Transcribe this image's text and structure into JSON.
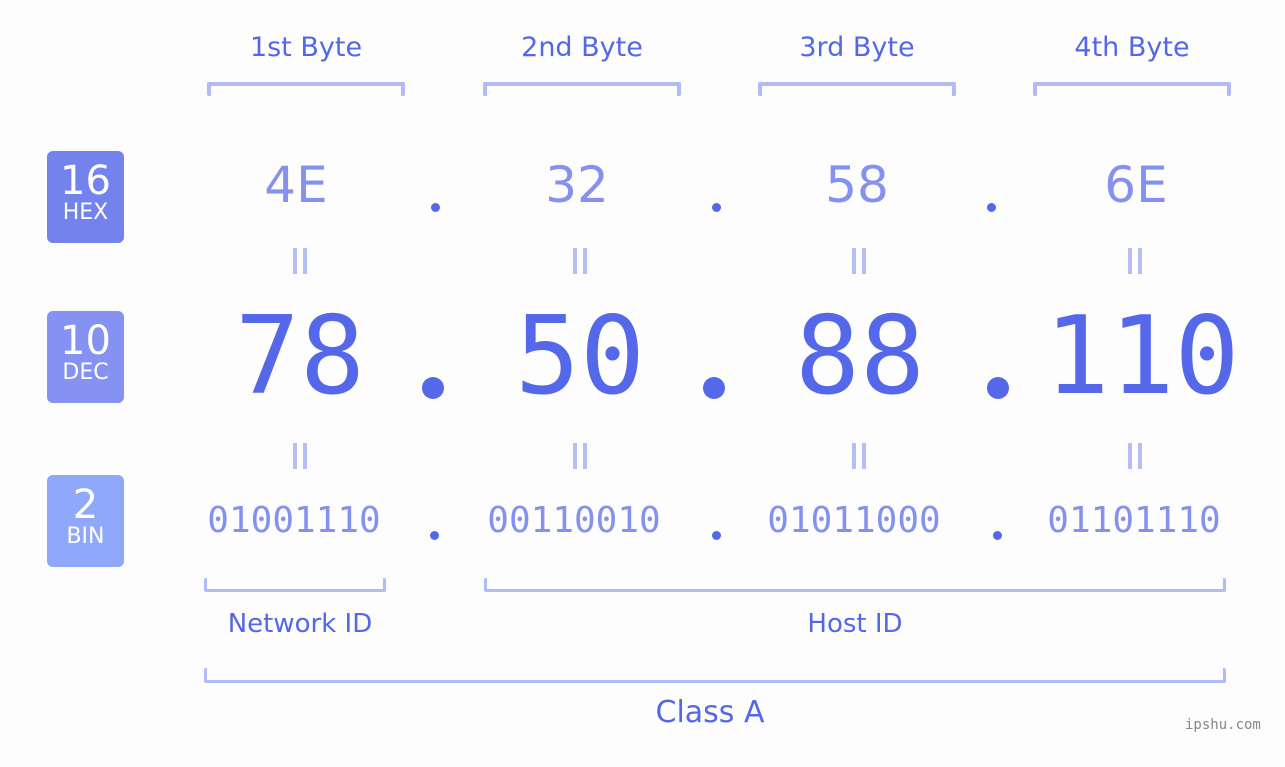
{
  "bytes": [
    {
      "label": "1st Byte",
      "hex": "4E",
      "dec": "78",
      "bin": "01001110"
    },
    {
      "label": "2nd Byte",
      "hex": "32",
      "dec": "50",
      "bin": "00110010"
    },
    {
      "label": "3rd Byte",
      "hex": "58",
      "dec": "88",
      "bin": "01011000"
    },
    {
      "label": "4th Byte",
      "hex": "6E",
      "dec": "110",
      "bin": "01101110"
    }
  ],
  "badges": {
    "hex": {
      "num": "16",
      "label": "HEX",
      "color": "#7382ec"
    },
    "dec": {
      "num": "10",
      "label": "DEC",
      "color": "#8592f2"
    },
    "bin": {
      "num": "2",
      "label": "BIN",
      "color": "#90a8fa"
    }
  },
  "network_id_label": "Network ID",
  "host_id_label": "Host ID",
  "class_label": "Class A",
  "watermark": "ipshu.com",
  "colors": {
    "accent": "#5568ea",
    "light": "#8591ee",
    "bracket": "#b1bbf5"
  }
}
